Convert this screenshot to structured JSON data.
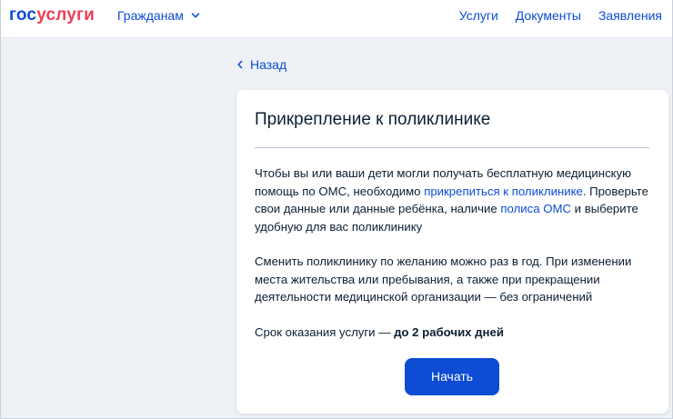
{
  "header": {
    "logo_part1": "гос",
    "logo_part2": "услуги",
    "citizens_menu": "Гражданам",
    "nav": [
      "Услуги",
      "Документы",
      "Заявления"
    ]
  },
  "back_link": "Назад",
  "card": {
    "title": "Прикрепление к поликлинике",
    "p1": {
      "t1": "Чтобы вы или ваши дети могли получать бесплатную медицинскую помощь по ОМС, необходимо ",
      "link1": "прикрепиться к поликлинике",
      "t2": ". Проверьте свои данные или данные ребёнка, наличие ",
      "link2": "полиса ОМС",
      "t3": " и выберите удобную для вас поликлинику"
    },
    "p2": "Сменить поликлинику по желанию можно раз в год. При изменении места жительства или пребывания, а также при прекращении деятельности медицинской организации — без ограничений",
    "p3": {
      "text": "Срок оказания услуги — ",
      "bold": "до 2 рабочих дней"
    },
    "start_button": "Начать"
  },
  "colors": {
    "brand_blue": "#0d4cd3",
    "brand_red": "#ee3f58",
    "text": "#0b1f33",
    "background": "#eef2f6"
  },
  "icons": {
    "citizens_chevron": "chevron-down-icon",
    "back_arrow": "chevron-left-icon"
  }
}
